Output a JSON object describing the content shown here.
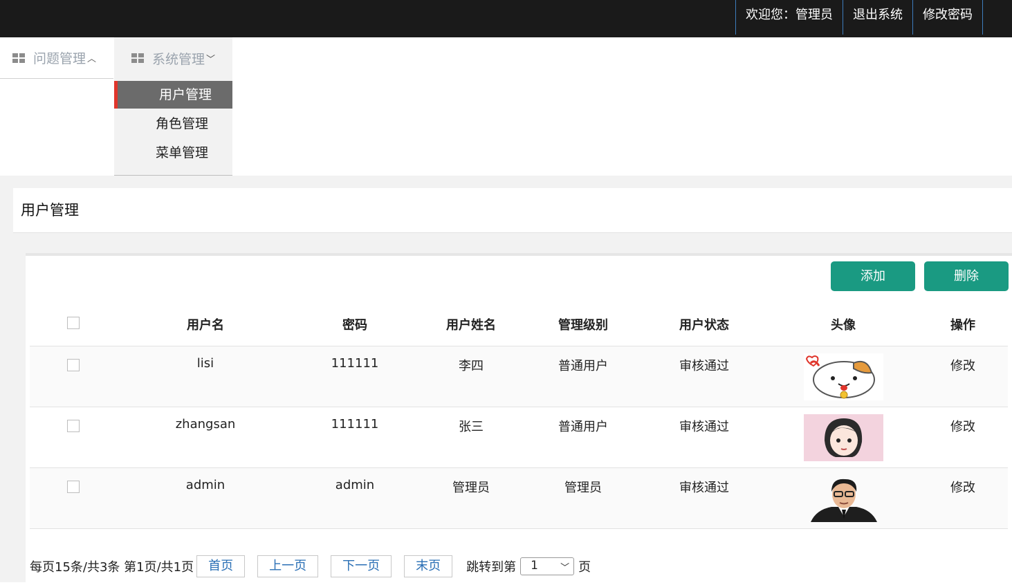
{
  "topbar": {
    "welcome": "欢迎您：管理员",
    "logout": "退出系统",
    "change_password": "修改密码"
  },
  "menu": {
    "items": [
      {
        "label": "问题管理",
        "icon": "grid-icon",
        "chevron": "chevron-up-icon"
      },
      {
        "label": "系统管理",
        "icon": "grid-icon",
        "chevron": "chevron-down-icon"
      }
    ],
    "submenu": [
      "用户管理",
      "角色管理",
      "菜单管理"
    ],
    "active_submenu": "用户管理"
  },
  "page": {
    "title": "用户管理"
  },
  "toolbar": {
    "add_label": "添加",
    "delete_label": "删除",
    "button_color": "#1a9a82"
  },
  "table": {
    "headers": [
      "用户名",
      "密码",
      "用户姓名",
      "管理级别",
      "用户状态",
      "头像",
      "操作"
    ],
    "rows": [
      {
        "username": "lisi",
        "password": "111111",
        "name": "李四",
        "level": "普通用户",
        "status": "审核通过",
        "avatar": "cat-avatar-icon",
        "action": "修改"
      },
      {
        "username": "zhangsan",
        "password": "111111",
        "name": "张三",
        "level": "普通用户",
        "status": "审核通过",
        "avatar": "girl-avatar-icon",
        "action": "修改"
      },
      {
        "username": "admin",
        "password": "admin",
        "name": "管理员",
        "level": "管理员",
        "status": "审核通过",
        "avatar": "man-avatar-icon",
        "action": "修改"
      }
    ]
  },
  "pagination": {
    "info": "每页15条/共3条 第1页/共1页",
    "first": "首页",
    "prev": "上一页",
    "next": "下一页",
    "last": "末页",
    "jump_prefix": "跳转到第",
    "jump_value": "1",
    "jump_suffix": "页"
  },
  "colors": {
    "topbar": "#1a1a1a",
    "active_menu_bg": "#6b6b6b",
    "active_marker": "#e0352b",
    "link": "#2a6fb5"
  }
}
